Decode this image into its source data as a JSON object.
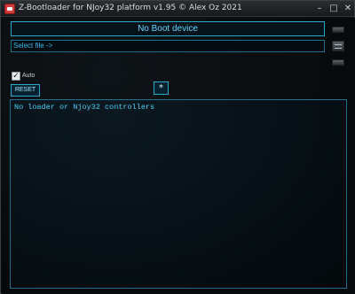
{
  "window": {
    "title": "Z-Bootloader for NJoy32 platform v1.95 © Alex Oz 2021",
    "controls": {
      "minimize": "–",
      "maximize": "□",
      "close": "✕"
    },
    "icon": "app-icon"
  },
  "status": {
    "text": "No Boot device"
  },
  "file": {
    "placeholder": "Select file ->"
  },
  "options": {
    "auto_label": "Auto",
    "auto_checked": true,
    "check_glyph": "✓"
  },
  "buttons": {
    "reset_label": "RESET",
    "star_label": "*"
  },
  "log": {
    "lines": [
      "No loader or Njoy32 controllers"
    ]
  },
  "colors": {
    "accent": "#2aa7c9",
    "text_cyan": "#4cd0f5",
    "background": "#0a0d10"
  }
}
